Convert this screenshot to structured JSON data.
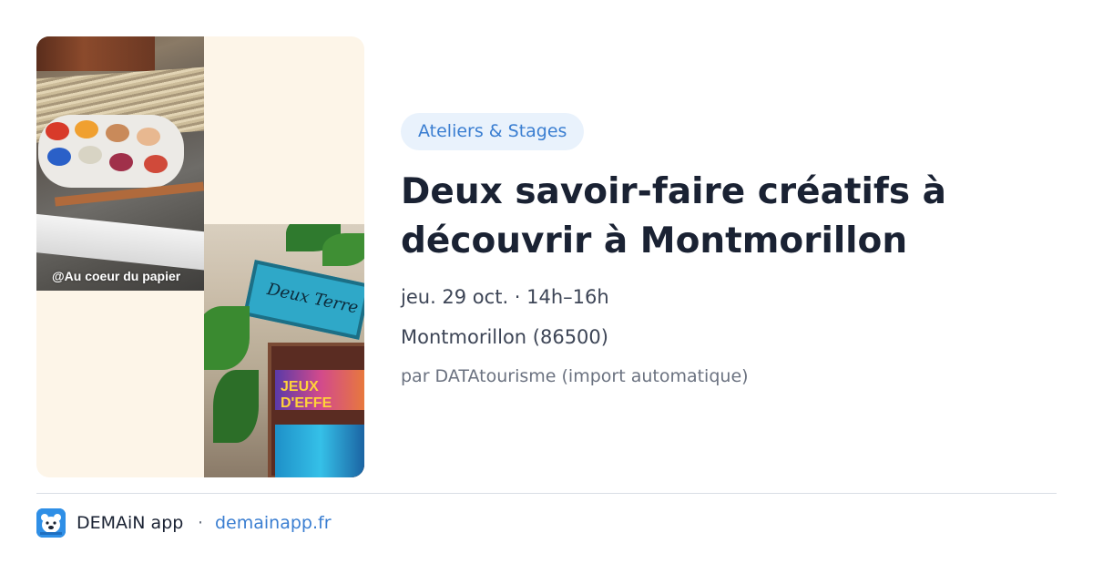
{
  "image": {
    "caption": "@Au coeur du papier",
    "sign_text": "Deux Terre",
    "banner_text": "JEUX D'EFFE"
  },
  "event": {
    "category": "Ateliers & Stages",
    "title": "Deux savoir-faire créatifs à découvrir à Montmorillon",
    "datetime": "jeu. 29 oct. · 14h–16h",
    "location": "Montmorillon (86500)",
    "source": "par DATAtourisme (import automatique)"
  },
  "footer": {
    "app_name": "DEMAiN app",
    "separator": "·",
    "link_text": "demainapp.fr",
    "logo_icon": "demain-bear-icon"
  },
  "colors": {
    "accent": "#3a7ed1",
    "tag_background": "#e9f2fc",
    "logo_background": "#2f8fe6",
    "image_background": "#fdf5e8"
  }
}
